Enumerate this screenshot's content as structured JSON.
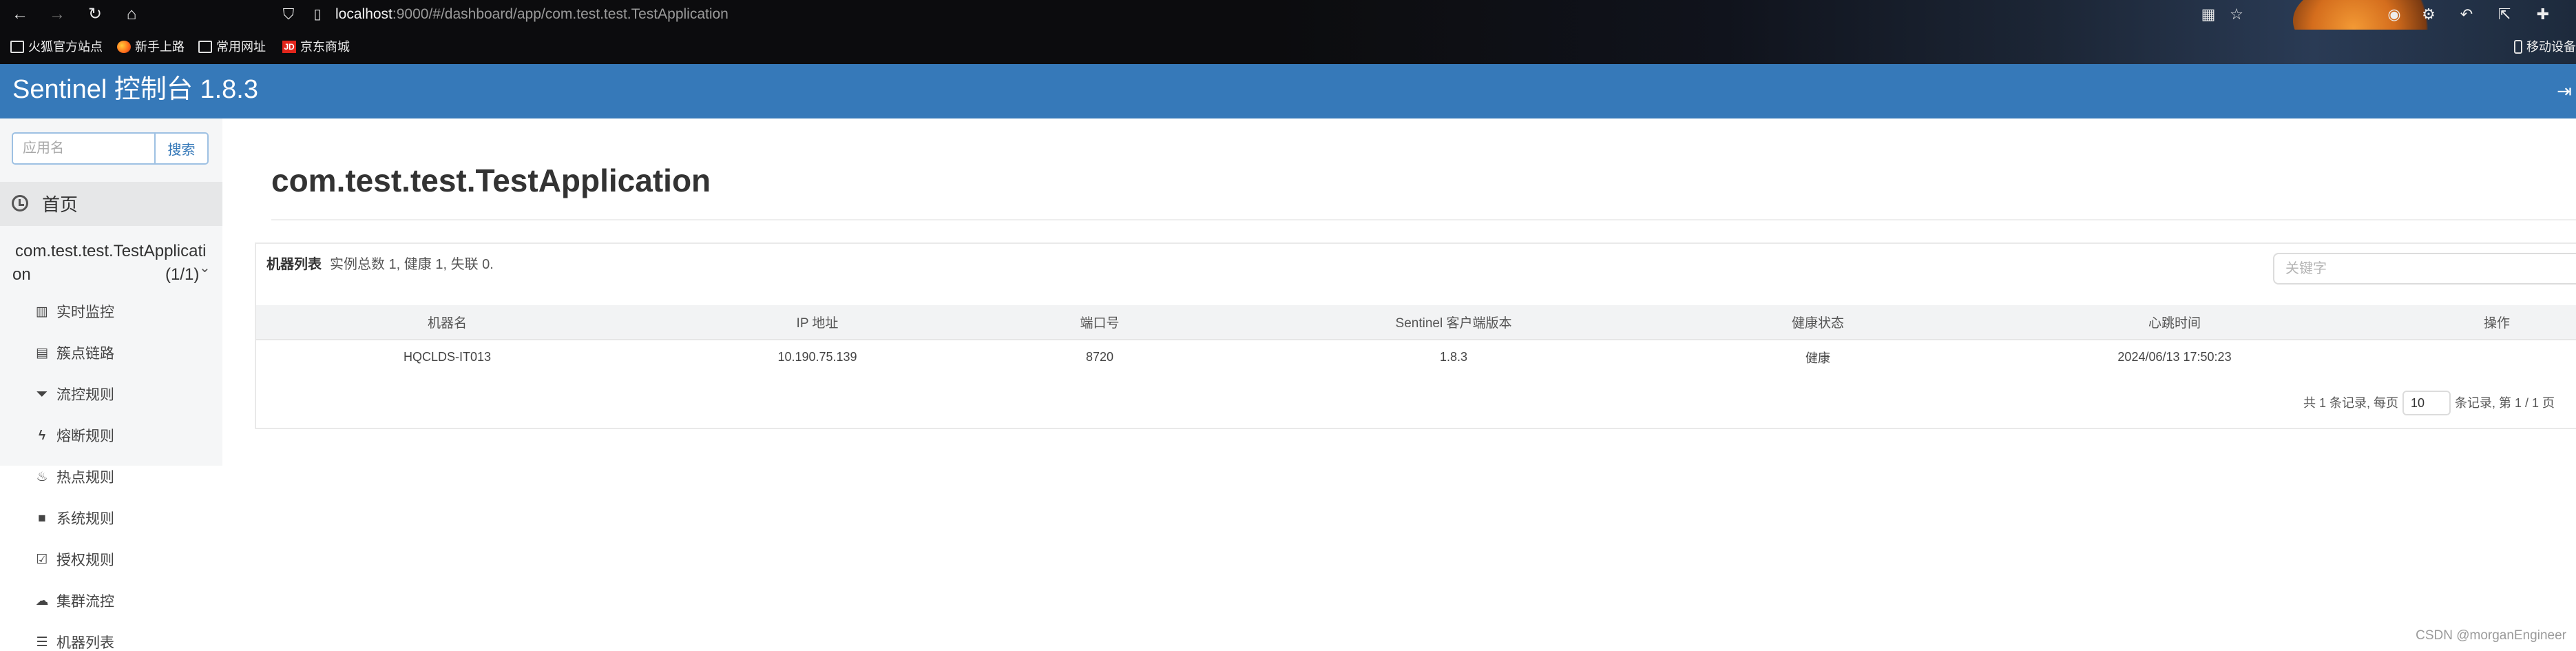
{
  "browser": {
    "url_host": "localhost",
    "url_rest": ":9000/#/dashboard/app/com.test.test.TestApplication",
    "bookmarks": [
      "火狐官方站点",
      "新手上路",
      "常用网址",
      "京东商城"
    ],
    "mobile_bookmarks": "移动设备",
    "jd_label": "JD",
    "icons": [
      "back-icon",
      "forward-icon",
      "reload-icon",
      "home-icon",
      "shield-icon",
      "page-icon",
      "qr-icon",
      "star-icon",
      "avatar-icon",
      "extension-icon",
      "undo-icon",
      "share-icon"
    ]
  },
  "app": {
    "title": "Sentinel 控制台 1.8.3"
  },
  "sidebar": {
    "search_placeholder": "应用名",
    "search_button": "搜索",
    "home": "首页",
    "app_name_line1": "com.test.test.TestApplicati",
    "app_name_line2": "on",
    "app_count": "(1/1)",
    "items": [
      {
        "label": "实时监控",
        "icon": "chart-icon"
      },
      {
        "label": "簇点链路",
        "icon": "list-icon"
      },
      {
        "label": "流控规则",
        "icon": "filter-icon"
      },
      {
        "label": "熔断规则",
        "icon": "bolt-icon"
      },
      {
        "label": "热点规则",
        "icon": "fire-icon"
      },
      {
        "label": "系统规则",
        "icon": "lock-icon"
      },
      {
        "label": "授权规则",
        "icon": "check-icon"
      },
      {
        "label": "集群流控",
        "icon": "cloud-icon"
      },
      {
        "label": "机器列表",
        "icon": "list-icon"
      }
    ]
  },
  "main": {
    "page_title": "com.test.test.TestApplication",
    "panel": {
      "heading": "机器列表",
      "summary": "实例总数 1, 健康 1, 失联 0.",
      "keyword_placeholder": "关键字"
    },
    "table": {
      "headers": [
        "机器名",
        "IP 地址",
        "端口号",
        "Sentinel 客户端版本",
        "健康状态",
        "心跳时间",
        "操作"
      ],
      "rows": [
        [
          "HQCLDS-IT013",
          "10.190.75.139",
          "8720",
          "1.8.3",
          "健康",
          "2024/06/13 17:50:23",
          ""
        ]
      ]
    },
    "pager": {
      "prefix": "共 1 条记录, 每页",
      "page_size": "10",
      "suffix": "条记录, 第 1 / 1 页"
    }
  },
  "watermark": "CSDN @morganEngineer"
}
